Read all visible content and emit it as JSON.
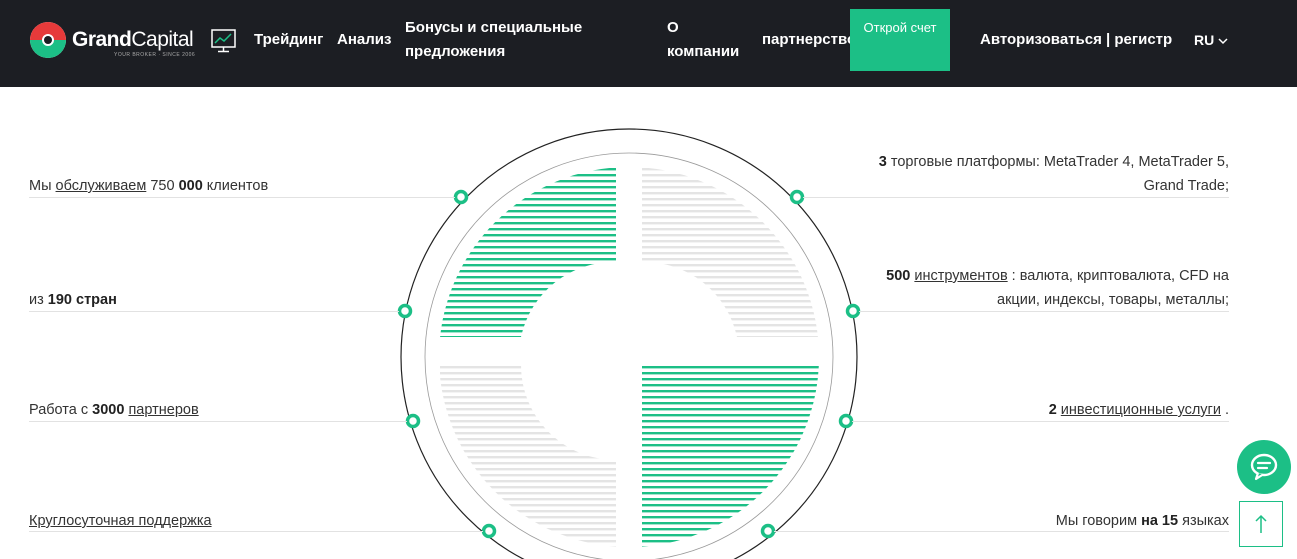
{
  "header": {
    "logo_grand": "Grand",
    "logo_capital": "Capital",
    "logo_sub": "YOUR BROKER  ·  SINCE 2006",
    "nav": {
      "trading": "Трейдинг",
      "analysis": "Анализ",
      "bonus": "Бонусы и специальные предложения",
      "about": "О компании",
      "partnership": "партнерство"
    },
    "cta_label": "Открой счет",
    "login_label": "Авторизоваться | регистр",
    "lang": "RU"
  },
  "facts_left": [
    {
      "pre": "Мы ",
      "link": "обслуживаем",
      "mid": " 750 ",
      "bold": "000",
      "post": " клиентов"
    },
    {
      "pre": "из ",
      "bold": "190 стран"
    },
    {
      "pre": "Работа с ",
      "bold": "3000",
      "mid": " ",
      "link": "партнеров"
    },
    {
      "link": "Круглосуточная поддержка"
    }
  ],
  "facts_right": [
    {
      "bold": "3",
      "post": " торговые платформы: MetaTrader 4, MetaTrader 5, Grand Trade;"
    },
    {
      "bold": "500",
      "mid": " ",
      "link": "инструментов",
      "post": " : валюта, криптовалюта, CFD на акции, индексы, товары, металлы;"
    },
    {
      "bold": "2",
      "mid": " ",
      "link": "инвестиционные услуги",
      "post": " ."
    },
    {
      "pre": "Мы говорим ",
      "bold": "на 15",
      "post": " языках"
    }
  ],
  "colors": {
    "header_bg": "#1c1e23",
    "accent": "#1cbf86",
    "logo_red": "#e63a3a"
  },
  "icons": [
    "monitor-chart-icon",
    "chevron-down-icon",
    "chat-icon",
    "arrow-up-icon"
  ]
}
